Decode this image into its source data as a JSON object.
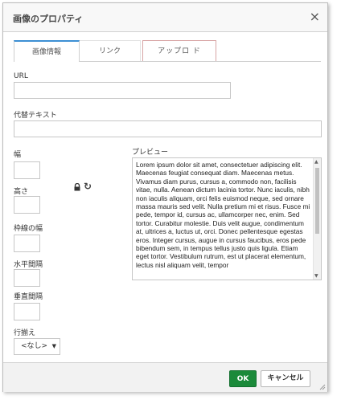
{
  "dialog": {
    "title": "画像のプロパティ",
    "close_glyph": "×"
  },
  "tabs": [
    {
      "label": "画像情報"
    },
    {
      "label": "リンク"
    },
    {
      "label": "アップロ ド"
    }
  ],
  "fields": {
    "url": {
      "label": "URL",
      "value": ""
    },
    "alt": {
      "label": "代替テキスト",
      "value": ""
    },
    "width": {
      "label": "幅",
      "value": ""
    },
    "height": {
      "label": "高さ",
      "value": ""
    },
    "border": {
      "label": "枠線の幅",
      "value": ""
    },
    "hspace": {
      "label": "水平間隔",
      "value": ""
    },
    "vspace": {
      "label": "垂直間隔",
      "value": ""
    },
    "align": {
      "label": "行揃え",
      "selected": "<なし>"
    }
  },
  "icons": {
    "lock": "lock-icon",
    "reset": "reset-size-icon",
    "reset_glyph": "↻",
    "select_arrow": "▼",
    "scroll_up": "▲",
    "scroll_down": "▼"
  },
  "preview": {
    "label": "プレビュー",
    "text": "Lorem ipsum dolor sit amet, consectetuer adipiscing elit. Maecenas feugiat consequat diam. Maecenas metus. Vivamus diam purus, cursus a, commodo non, facilisis vitae, nulla. Aenean dictum lacinia tortor. Nunc iaculis, nibh non iaculis aliquam, orci felis euismod neque, sed ornare massa mauris sed velit. Nulla pretium mi et risus. Fusce mi pede, tempor id, cursus ac, ullamcorper nec, enim. Sed tortor. Curabitur molestie. Duis velit augue, condimentum at, ultrices a, luctus ut, orci. Donec pellentesque egestas eros. Integer cursus, augue in cursus faucibus, eros pede bibendum sem, in tempus tellus justo quis ligula. Etiam eget tortor. Vestibulum rutrum, est ut placerat elementum, lectus nisl aliquam velit, tempor"
  },
  "footer": {
    "ok_label": "OK",
    "cancel_label": "キャンセル"
  },
  "colors": {
    "accent": "#3d8fd4",
    "ok_button": "#1b8a3a"
  }
}
